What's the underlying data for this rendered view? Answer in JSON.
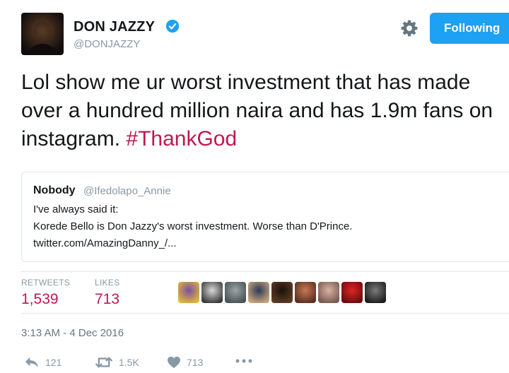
{
  "tweet": {
    "author_name": "DON JAZZY",
    "author_handle": "@DONJAZZY",
    "follow_label": "Following",
    "text_main": "Lol show me ur worst investment that has made over a hundred million naira and has 1.9m fans on instagram. ",
    "hashtag": "#ThankGod",
    "timestamp": "3:13 AM - 4 Dec 2016"
  },
  "quoted": {
    "name": "Nobody",
    "handle": "@Ifedolapo_Annie",
    "line1": "I've always said it:",
    "line2": "Korede Bello is Don Jazzy's worst investment. Worse than D'Prince.",
    "line3": "twitter.com/AmazingDanny_/..."
  },
  "stats": {
    "retweets_label": "RETWEETS",
    "retweets_value": "1,539",
    "likes_label": "LIKES",
    "likes_value": "713"
  },
  "liker_avatars": [
    {
      "name": "liker-avatar-1",
      "colors": [
        "#7a4fa0",
        "#e0b43a"
      ]
    },
    {
      "name": "liker-avatar-2",
      "colors": [
        "#d8d8d8",
        "#3b3b3b"
      ]
    },
    {
      "name": "liker-avatar-3",
      "colors": [
        "#9aa3a6",
        "#4a5356"
      ]
    },
    {
      "name": "liker-avatar-4",
      "colors": [
        "#2a3a55",
        "#c9a27c"
      ]
    },
    {
      "name": "liker-avatar-5",
      "colors": [
        "#1a120c",
        "#5b3a24"
      ]
    },
    {
      "name": "liker-avatar-6",
      "colors": [
        "#c87955",
        "#5a2f22"
      ]
    },
    {
      "name": "liker-avatar-7",
      "colors": [
        "#d9b2a4",
        "#7a5b52"
      ]
    },
    {
      "name": "liker-avatar-8",
      "colors": [
        "#e02424",
        "#6b0d0d"
      ]
    },
    {
      "name": "liker-avatar-9",
      "colors": [
        "#7b7b7b",
        "#1e1e1e"
      ]
    }
  ],
  "actions": {
    "reply_count": "121",
    "retweet_count": "1.5K",
    "like_count": "713"
  },
  "colors": {
    "accent": "#1da1f2",
    "hashtag": "#c1184f",
    "muted": "#8899a6"
  },
  "icons": [
    "verified-badge-icon",
    "gear-icon",
    "reply-icon",
    "retweet-icon",
    "heart-icon",
    "more-icon"
  ]
}
